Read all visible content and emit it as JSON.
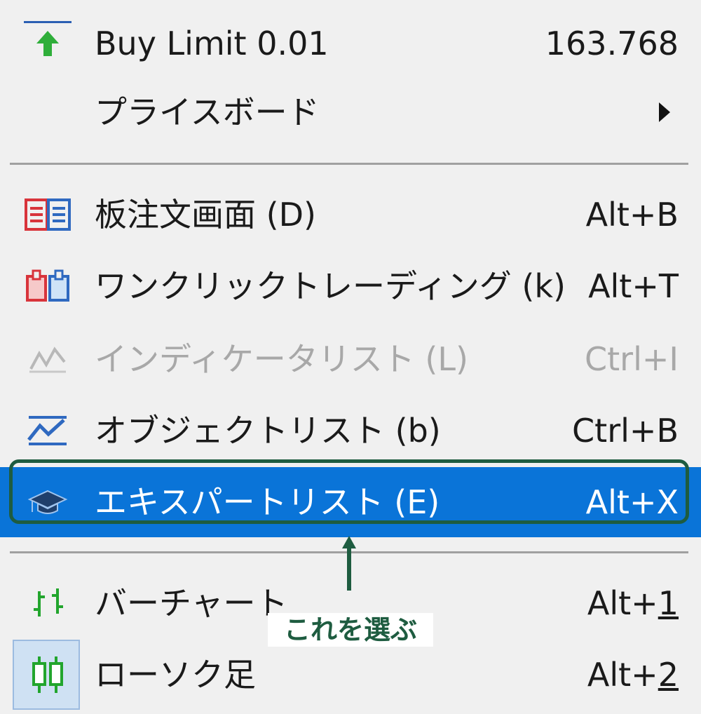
{
  "menu": {
    "buy_limit": {
      "label": "Buy Limit 0.01",
      "shortcut": "163.768",
      "icon": "buy-limit-arrow-icon"
    },
    "price_board": {
      "label": "プライスボード",
      "icon": "submenu-arrow-icon"
    },
    "board_order": {
      "label": "板注文画面 (D)",
      "shortcut": "Alt+B",
      "icon": "board-order-icon"
    },
    "one_click": {
      "label": "ワンクリックトレーディング (k)",
      "shortcut": "Alt+T",
      "icon": "one-click-trading-icon"
    },
    "indicator_list": {
      "label": "インディケータリスト (L)",
      "shortcut": "Ctrl+I",
      "icon": "indicator-icon",
      "disabled": true
    },
    "object_list": {
      "label": "オブジェクトリスト (b)",
      "shortcut": "Ctrl+B",
      "icon": "object-list-icon"
    },
    "expert_list": {
      "label": "エキスパートリスト (E)",
      "shortcut": "Alt+X",
      "icon": "graduation-cap-icon",
      "selected": true
    },
    "bar_chart": {
      "label": "バーチャート",
      "shortcut_prefix": "Alt+",
      "shortcut_key": "1",
      "icon": "bar-chart-icon"
    },
    "candlestick": {
      "label": "ローソク足",
      "shortcut_prefix": "Alt+",
      "shortcut_key": "2",
      "icon": "candlestick-icon"
    }
  },
  "annotation": {
    "callout_text": "これを選ぶ"
  },
  "colors": {
    "selected_bg": "#0a74d8",
    "annotation": "#1e5c40",
    "disabled_text": "#a8a8a8"
  }
}
